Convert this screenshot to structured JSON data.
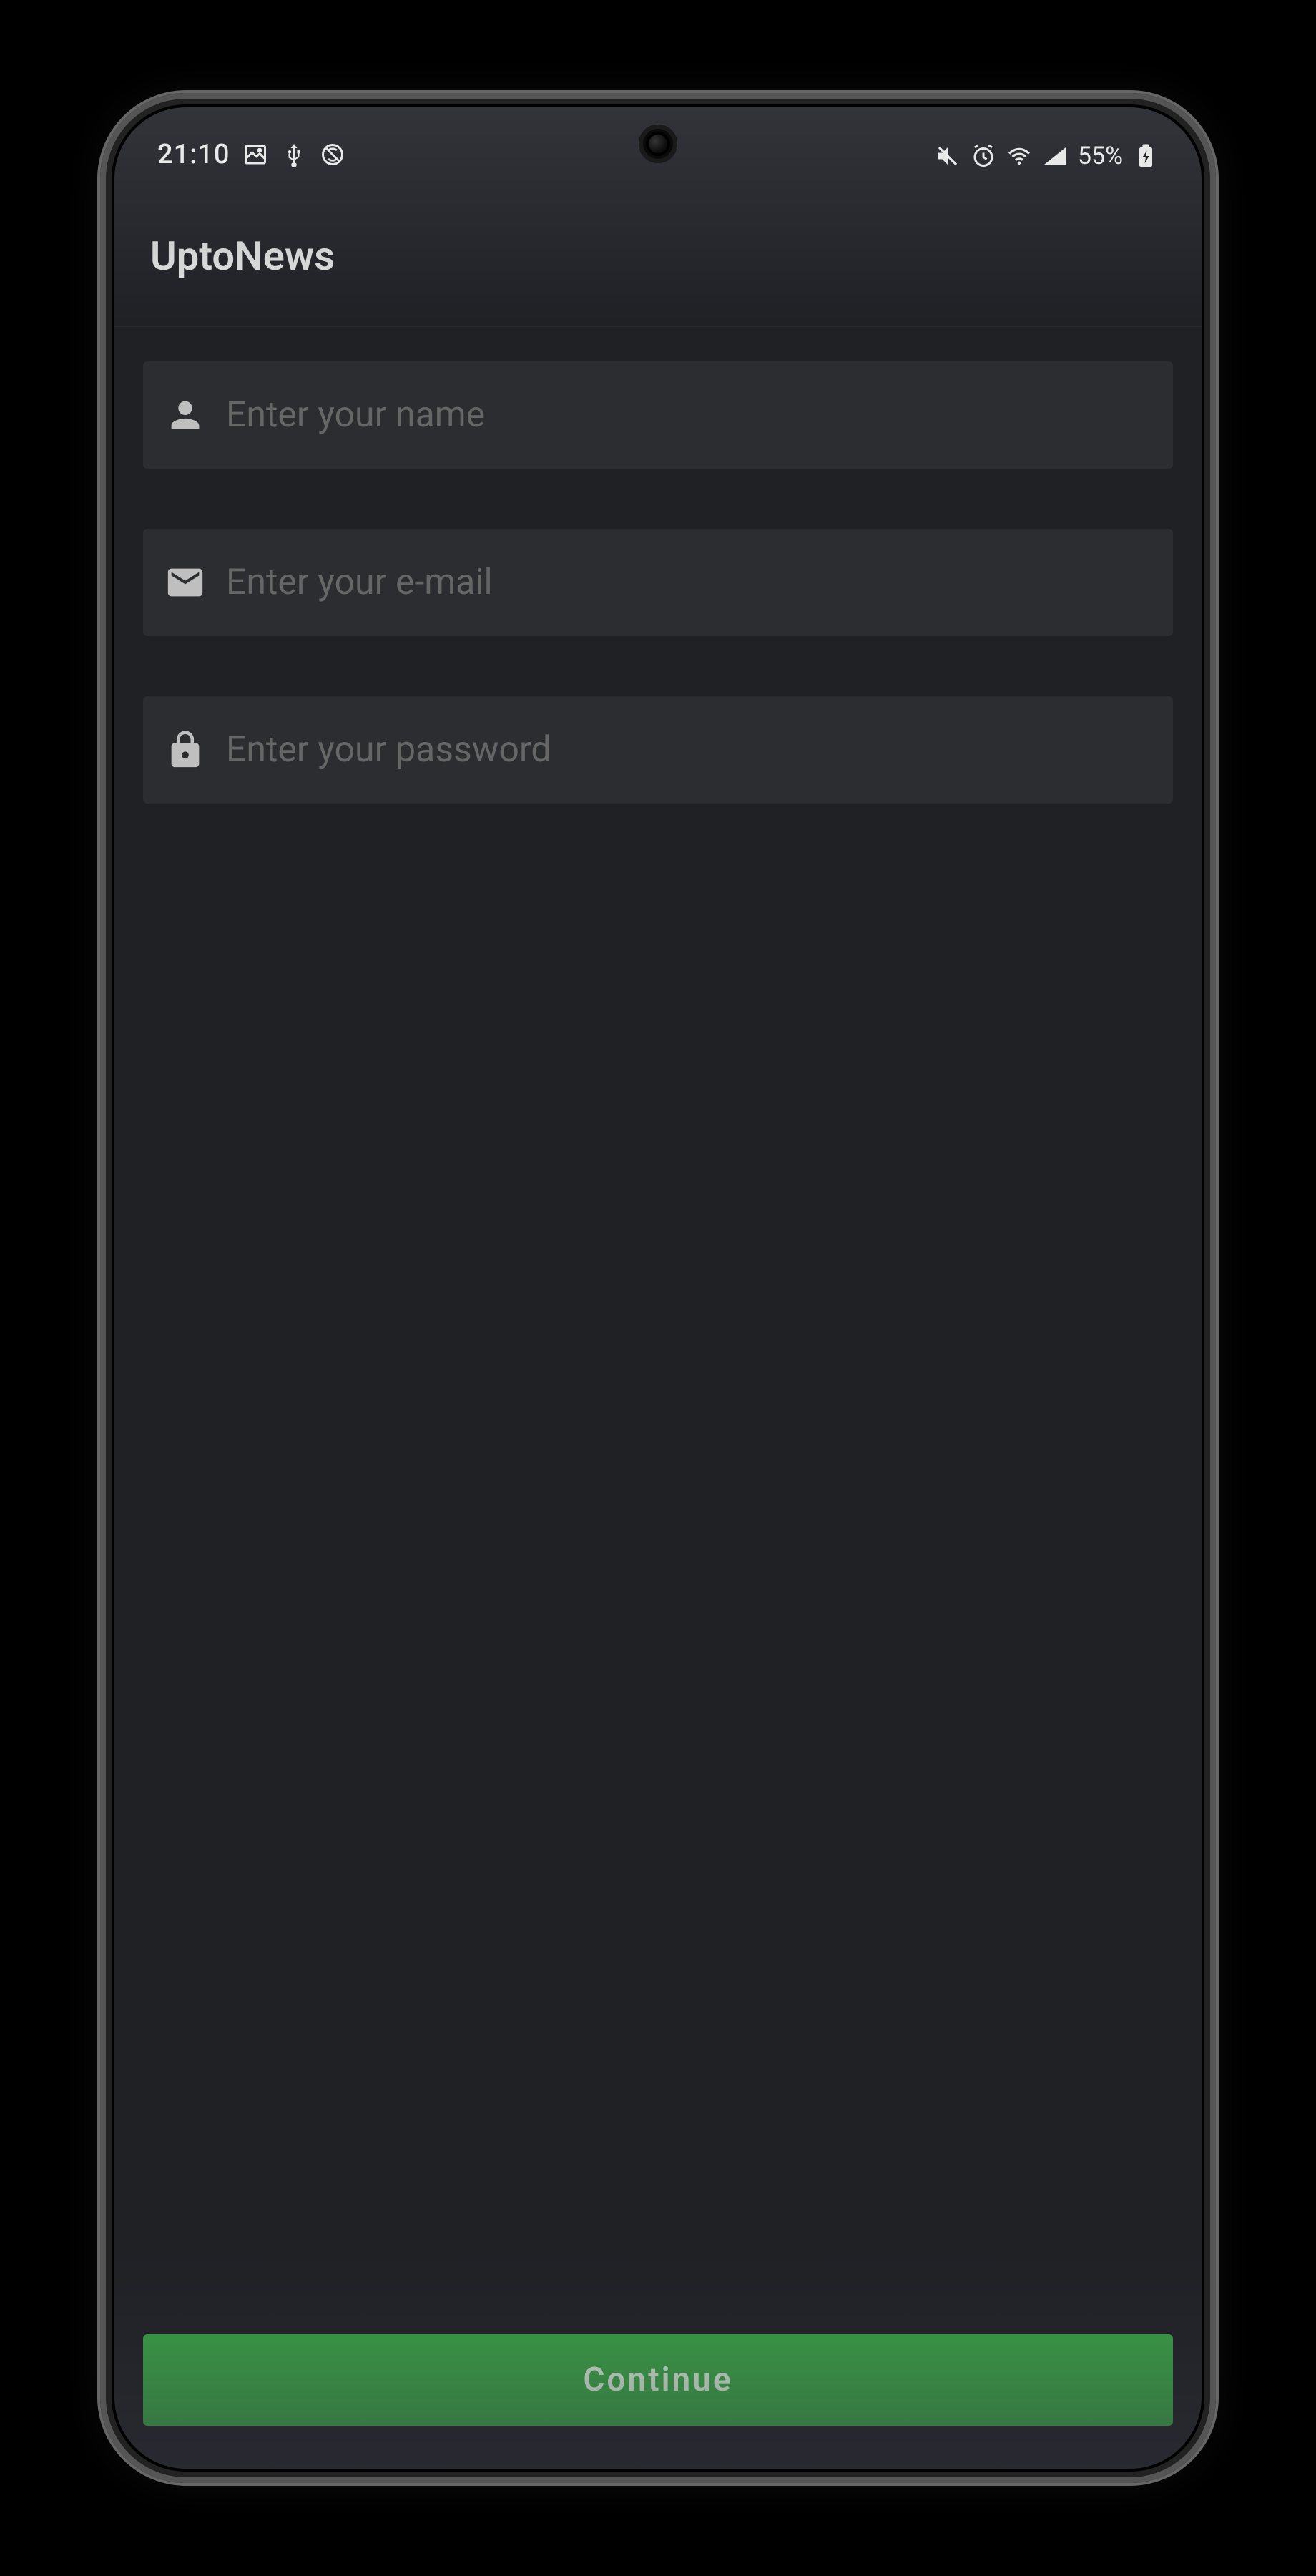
{
  "statusBar": {
    "time": "21:10",
    "batteryText": "55%"
  },
  "header": {
    "title": "UptoNews"
  },
  "form": {
    "namePlaceholder": "Enter your name",
    "emailPlaceholder": "Enter your e-mail",
    "passwordPlaceholder": "Enter your password"
  },
  "actions": {
    "continueLabel": "Continue"
  }
}
